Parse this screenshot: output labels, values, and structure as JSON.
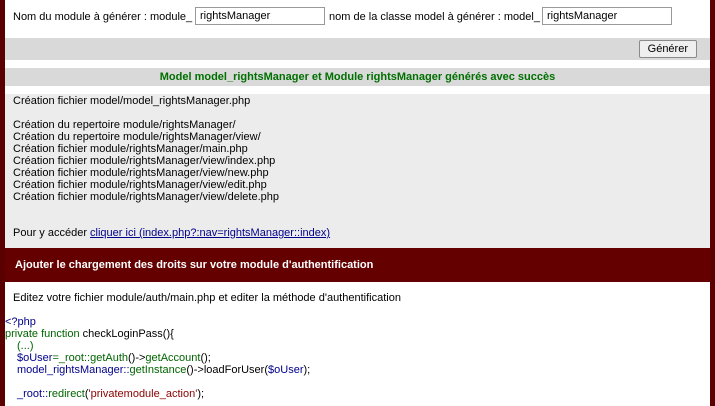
{
  "form": {
    "module_label": "Nom du module à générer : module_",
    "module_value": "rightsManager",
    "class_label": "nom de la classe model à générer : model_",
    "class_value": "rightsManager",
    "generate_button": "Générer"
  },
  "success_message": "Model model_rightsManager et Module rightsManager générés avec succès",
  "files": {
    "model_line": "Création fichier model/model_rightsManager.php",
    "lines": [
      "Création du repertoire module/rightsManager/",
      "Création du repertoire module/rightsManager/view/",
      "Création fichier module/rightsManager/main.php",
      "Création fichier module/rightsManager/view/index.php",
      "Création fichier module/rightsManager/view/new.php",
      "Création fichier module/rightsManager/view/edit.php",
      "Création fichier module/rightsManager/view/delete.php"
    ],
    "access_label": "Pour y accéder",
    "access_link": "cliquer ici (index.php?:nav=rightsManager::index)"
  },
  "auth": {
    "title": "Ajouter le chargement des droits sur votre module d'authentification",
    "instruction": "Editez votre fichier module/auth/main.php et editer la méthode d'authentification"
  },
  "code": {
    "open_tag": "<?php",
    "fn_kw": "private function",
    "fn_name": "checkLoginPass",
    "fn_tail": "(){",
    "ellipsis": "(...)",
    "l3_var": "$oUser",
    "l3_a": "=_root::",
    "l3_b": "getAuth",
    "l3_c": "()->",
    "l3_d": "getAccount",
    "l3_e": "();",
    "l4_a": "model_rightsManager::",
    "l4_b": "getInstance",
    "l4_c": "()->",
    "l4_d": "loadForUser",
    "l4_e": "(",
    "l4_f": "$oUser",
    "l4_g": ");",
    "l5_a": "_root::",
    "l5_b": "redirect",
    "l5_c": "(",
    "l5_d": "'privatemodule_action'",
    "l5_e": ");"
  }
}
